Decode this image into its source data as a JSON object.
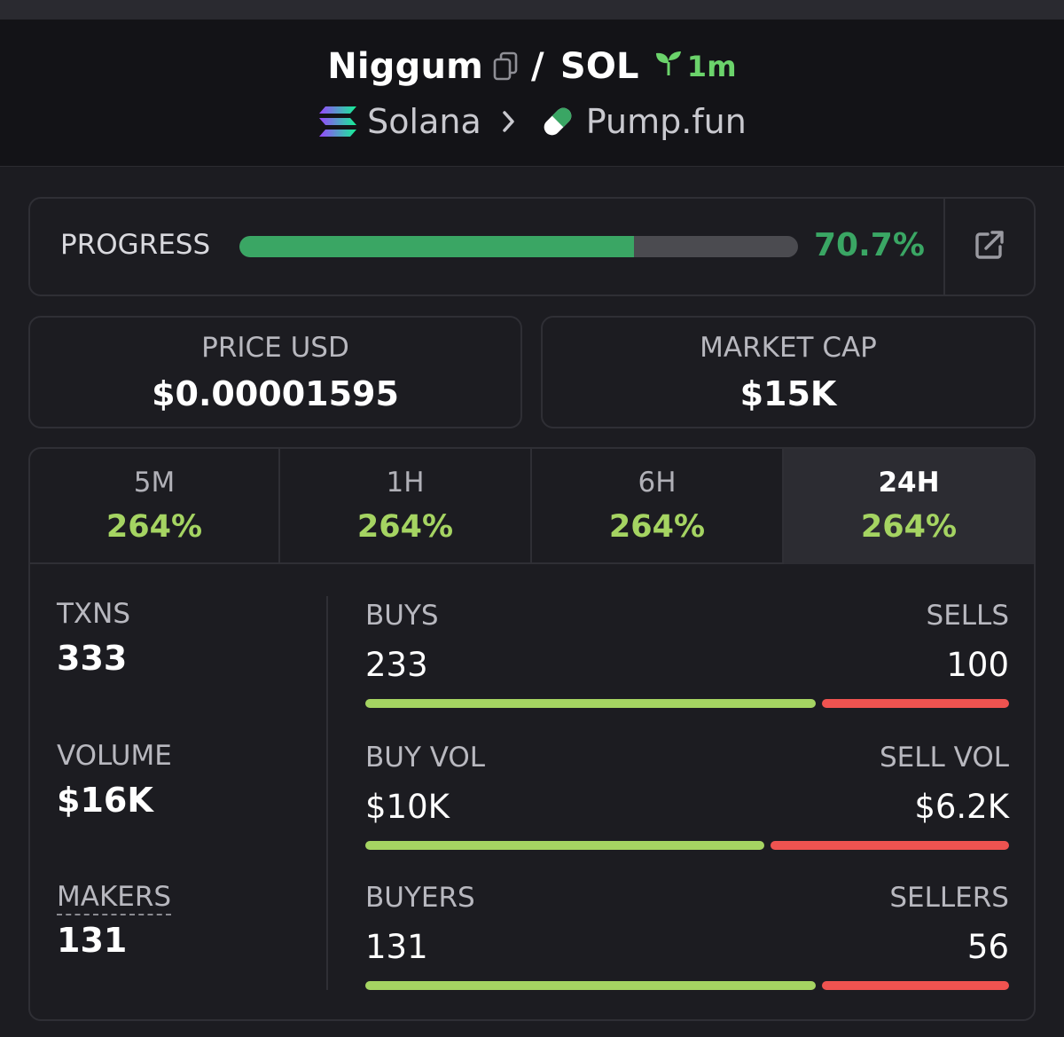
{
  "header": {
    "token_name": "Niggum",
    "separator": "/",
    "quote": "SOL",
    "age": "1m",
    "chain": "Solana",
    "dex": "Pump.fun"
  },
  "progress": {
    "label": "PROGRESS",
    "value_text": "70.7%",
    "fraction": 0.707
  },
  "price": {
    "label": "PRICE USD",
    "value": "$0.00001595"
  },
  "market_cap": {
    "label": "MARKET CAP",
    "value": "$15K"
  },
  "tabs": [
    {
      "label": "5M",
      "value": "264%"
    },
    {
      "label": "1H",
      "value": "264%"
    },
    {
      "label": "6H",
      "value": "264%"
    },
    {
      "label": "24H",
      "value": "264%",
      "active": true
    }
  ],
  "stats": {
    "txns": {
      "label": "TXNS",
      "value": "333"
    },
    "volume": {
      "label": "VOLUME",
      "value": "$16K"
    },
    "makers": {
      "label": "MAKERS",
      "value": "131"
    },
    "buys": {
      "left_label": "BUYS",
      "left_value": "233",
      "right_label": "SELLS",
      "right_value": "100",
      "buy_fraction": 0.7
    },
    "buy_vol": {
      "left_label": "BUY VOL",
      "left_value": "$10K",
      "right_label": "SELL VOL",
      "right_value": "$6.2K",
      "buy_fraction": 0.62
    },
    "buyers": {
      "left_label": "BUYERS",
      "left_value": "131",
      "right_label": "SELLERS",
      "right_value": "56",
      "buy_fraction": 0.7
    }
  },
  "colors": {
    "accent_green": "#3aa664",
    "change_green": "#a5d462",
    "sell_red": "#ef5350",
    "background": "#1c1c21",
    "header_bg": "#131317"
  },
  "icons": [
    "copy-icon",
    "seedling-icon",
    "solana-logo-icon",
    "chevron-right-icon",
    "pill-icon",
    "external-link-icon"
  ]
}
